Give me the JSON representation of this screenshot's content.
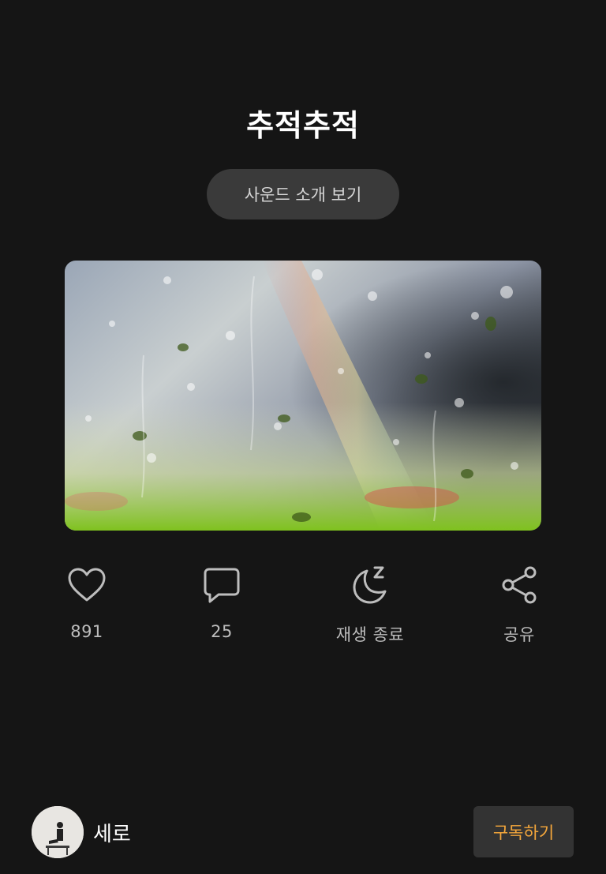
{
  "sound": {
    "title": "추적추적",
    "intro_button_label": "사운드 소개 보기",
    "cover_image": "rain-on-window-rainbow"
  },
  "actions": [
    {
      "icon": "heart-icon",
      "label": "891"
    },
    {
      "icon": "comment-icon",
      "label": "25"
    },
    {
      "icon": "moon-sleep-icon",
      "label": "재생 종료"
    },
    {
      "icon": "share-icon",
      "label": "공유"
    }
  ],
  "creator": {
    "name": "세로",
    "subscribe_label": "구독하기"
  },
  "colors": {
    "background": "#151515",
    "button_bg": "#3a3a3a",
    "accent": "#f5a73b",
    "icon": "#bdbdbd"
  }
}
